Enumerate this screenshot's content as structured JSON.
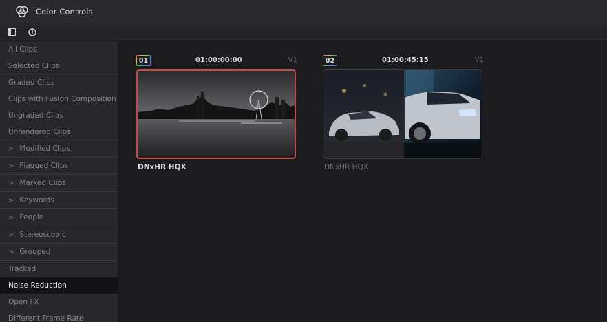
{
  "window": {
    "title": "Color Controls"
  },
  "toolbar": {
    "buttons": [
      "sidebar-toggle",
      "info"
    ]
  },
  "sidebar": {
    "items": [
      {
        "label": "All Clips"
      },
      {
        "label": "Selected Clips"
      },
      {
        "label": "Graded Clips"
      },
      {
        "label": "Clips with Fusion Composition"
      },
      {
        "label": "Ungraded Clips"
      },
      {
        "label": "Unrendered Clips"
      },
      {
        "label": "Modified Clips",
        "chevron": ">"
      },
      {
        "label": "Flagged Clips",
        "chevron": ">"
      },
      {
        "label": "Marked Clips",
        "chevron": ">"
      },
      {
        "label": "Keywords",
        "chevron": ">"
      },
      {
        "label": "People",
        "chevron": ">"
      },
      {
        "label": "Stereoscopic",
        "chevron": ">"
      },
      {
        "label": "Grouped",
        "chevron": ">"
      },
      {
        "label": "Tracked"
      },
      {
        "label": "Noise Reduction"
      },
      {
        "label": "Open FX"
      },
      {
        "label": "Different Frame Rate"
      }
    ]
  },
  "clips": [
    {
      "number": "01",
      "timecode": "01:00:00:00",
      "track": "V1",
      "codec": "DNxHR HQX",
      "selected": true
    },
    {
      "number": "02",
      "timecode": "01:00:45:15",
      "track": "V1",
      "codec": "DNxHR HQX",
      "selected": false
    }
  ],
  "colors": {
    "selection_border": "#c64a4a",
    "badge_gradient": [
      "#e85050",
      "#e8c040",
      "#40c060",
      "#4080e8",
      "#b050e0"
    ]
  }
}
